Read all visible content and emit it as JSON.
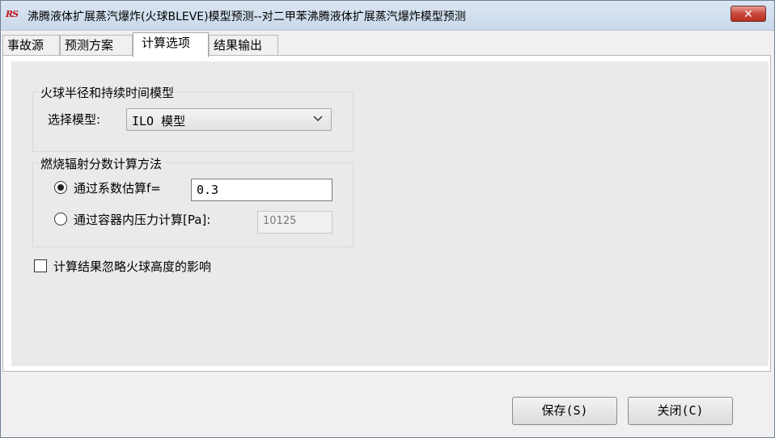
{
  "window": {
    "icon_text": "RS",
    "title": "沸腾液体扩展蒸汽爆炸(火球BLEVE)模型预测--对二甲苯沸腾液体扩展蒸汽爆炸模型预测",
    "close_glyph": "✕"
  },
  "tabs": [
    {
      "label": "事故源",
      "active": false
    },
    {
      "label": "预测方案",
      "active": false
    },
    {
      "label": "计算选项",
      "active": true
    },
    {
      "label": "结果输出",
      "active": false
    }
  ],
  "fireball_model": {
    "group_title": "火球半径和持续时间模型",
    "select_label": "选择模型:",
    "selected_value": "ILO 模型"
  },
  "radiation_fraction": {
    "group_title": "燃烧辐射分数计算方法",
    "options": [
      {
        "label": "通过系数估算f=",
        "selected": true,
        "value": "0.3"
      },
      {
        "label": "通过容器内压力计算[Pa]:",
        "selected": false,
        "value": "10125"
      }
    ]
  },
  "ignore_height": {
    "label": "计算结果忽略火球高度的影响",
    "checked": false
  },
  "buttons": {
    "save": "保存(S)",
    "close": "关闭(C)"
  }
}
